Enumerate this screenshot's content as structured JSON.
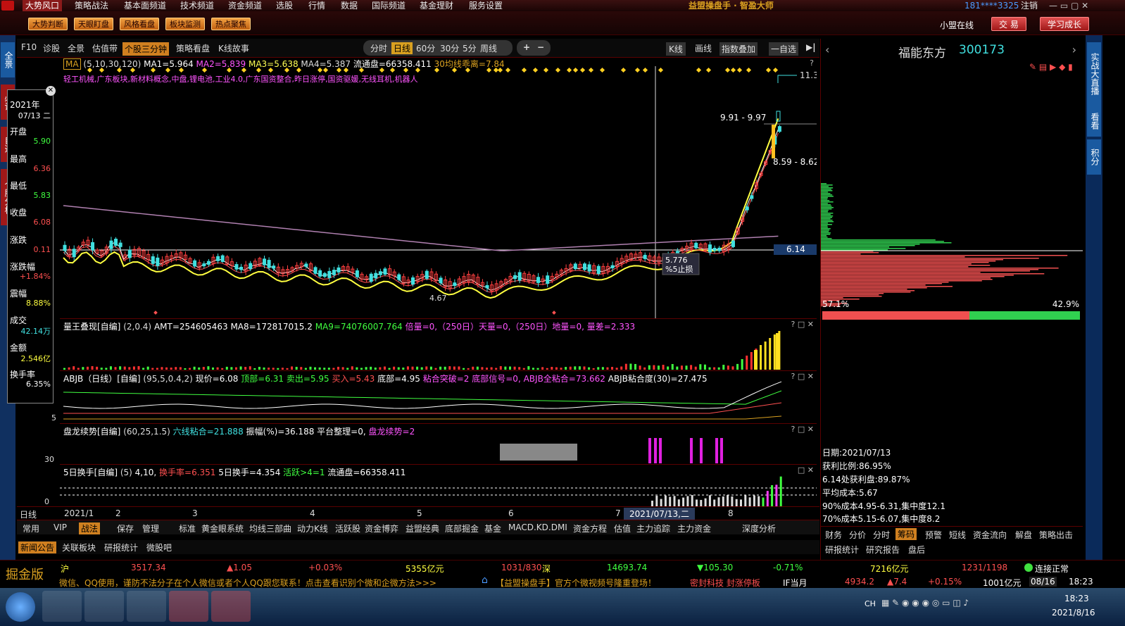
{
  "menu": {
    "items": [
      "大势风口",
      "策略战法",
      "基本面频道",
      "技术频道",
      "资金频道",
      "选股",
      "行情",
      "数据",
      "国际频道",
      "基金理财",
      "服务设置"
    ],
    "app_title": "益盟操盘手 · 智盈大师",
    "user": "181****3325",
    "logout": "注销"
  },
  "toolbar": {
    "buttons": [
      "大势判断",
      "天眼盯盘",
      "风格看盘",
      "板块监测",
      "热点聚焦"
    ],
    "online": "小盟在线",
    "trade": "交 易",
    "learn": "学习成长"
  },
  "chart_tabs": {
    "left": [
      "F10",
      "诊股",
      "全景",
      "估值带",
      "个股三分钟",
      "策略看盘",
      "K线故事"
    ],
    "periods": [
      "分时",
      "日线",
      "60分",
      "30分",
      "5分",
      "周线"
    ],
    "zoom_in": "+",
    "zoom_out": "−",
    "right": [
      "K线",
      "画线",
      "指数叠加",
      "一自选"
    ]
  },
  "main_chart": {
    "ma_label": "MA",
    "params": "(5,10,30,120)",
    "ma1": "MA1=5.964",
    "ma2": "MA2=5.839",
    "ma3": "MA3=5.638",
    "ma4": "MA4=5.387",
    "float": "流通盘=66358.411",
    "dev": "30均线乖离=7.84",
    "concepts": "轻工机械,广东板块,新材料概念,中盘,锂电池,工业4.0,广东国资整合,昨日涨停,国资驱媛,无线耳机,机器人",
    "high": "11.38",
    "range1": "9.91 - 9.97",
    "range2": "8.59 - 8.62",
    "low": "4.67",
    "cur": "6.14",
    "tip1": "5.776",
    "tip2": "%5止损",
    "help": "?"
  },
  "sub1": {
    "title": "量王叠现[自编]",
    "params": "(2,0.4)",
    "amt": "AMT=254605463",
    "ma8": "MA8=172817015.2",
    "ma9": "MA9=74076007.764",
    "bl": "倍量=0,（250日）天量=0,（250日）地量=0,",
    "lc": "量差=2.333"
  },
  "sub2": {
    "title": "ABJB（日线）[自编]",
    "params": "(95,5,0.4,2)",
    "xj": "现价=6.08",
    "db": "顶部=6.31",
    "mc": "卖出=5.95",
    "mr": "买入=5.43",
    "dib": "底部=4.95",
    "nh": "粘合突破=2",
    "dbx": "底部信号=0,",
    "abjb": "ABJB全粘合=73.662",
    "abjb2": "ABJB粘合度(30)=27.475",
    "axis": "5"
  },
  "sub3": {
    "title": "盘龙续势[自编]",
    "params": "(60,25,1.5)",
    "lx": "六线粘合=21.888",
    "zf": "振幅(%)=36.188",
    "pt": "平台整理=0,",
    "pl": "盘龙续势=2",
    "axis": "30"
  },
  "sub4": {
    "title": "5日换手[自编]",
    "params": "(5)",
    "p2": "4,10,",
    "hs": "换手率=6.351",
    "hs5": "5日换手=4.354",
    "hy": "活跃>4=1",
    "lt": "流通盘=66358.411",
    "axis": "0"
  },
  "xaxis": {
    "label": "日线",
    "ticks": [
      "2021/1",
      "2",
      "3",
      "4",
      "5",
      "6",
      "7",
      "8"
    ],
    "cursor": "2021/07/13,二"
  },
  "infobox": {
    "year": "2021年",
    "date": "07/13 二",
    "open_l": "开盘",
    "open": "5.90",
    "high_l": "最高",
    "high": "6.36",
    "low_l": "最低",
    "low": "5.83",
    "close_l": "收盘",
    "close": "6.08",
    "chg_l": "涨跌",
    "chg": "0.11",
    "pct_l": "涨跌幅",
    "pct": "+1.84%",
    "amp_l": "震幅",
    "amp": "8.88%",
    "vol_l": "成交",
    "vol": "42.14万",
    "amt_l": "金额",
    "amt": "2.546亿",
    "turn_l": "换手率",
    "turn": "6.35%"
  },
  "leftbar": [
    "全景",
    "必读",
    "自选",
    "个股分析"
  ],
  "stock": {
    "name": "福能东方",
    "code": "300173"
  },
  "chip": {
    "left_pct": "57.1%",
    "right_pct": "42.9%",
    "date": "日期:2021/07/13",
    "profit": "获利比例:86.95%",
    "at": "6.14处获利盘:89.87%",
    "avg": "平均成本:5.67",
    "c90": "90%成本4.95-6.31,集中度12.1",
    "c70": "70%成本5.15-6.07,集中度8.2"
  },
  "right_tabs": [
    "财务",
    "分价",
    "分时",
    "筹码",
    "预警",
    "短线",
    "资金流向",
    "解盘",
    "策略出击"
  ],
  "right_tabs2": [
    "研报统计",
    "研究报告",
    "盘后"
  ],
  "rightbar": [
    "实战大直播",
    "看看",
    "积分"
  ],
  "bottom_tabs": {
    "left": [
      "常用",
      "VIP",
      "战法",
      "保存",
      "管理"
    ],
    "items": [
      "标准",
      "黄金眼系统",
      "均线三部曲",
      "动力K线",
      "活跃股",
      "资金博弈",
      "益盟经典",
      "底部掘金",
      "基金",
      "MACD.KD.DMI",
      "资金方程",
      "估值",
      "主力追踪",
      "主力资金"
    ],
    "right": "深度分析"
  },
  "news_tabs": [
    "新闻公告",
    "关联板块",
    "研报统计",
    "微股吧"
  ],
  "status": {
    "brand": "掘金版",
    "sh_l": "沪",
    "sh": "3517.34",
    "sh_chg": "▲1.05",
    "sh_pct": "+0.03%",
    "sh_amt": "5355亿元",
    "sh_ud": "1031/830",
    "sz_l": "深",
    "sz": "14693.74",
    "sz_chg": "▼105.30",
    "sz_pct": "-0.71%",
    "sz_amt": "7216亿元",
    "sz_ud": "1231/1198",
    "conn": "连接正常",
    "ticker": "微信、QQ使用，谨防不法分子在个人微信或者个人QQ跟您联系！点击查看识别个微和企微方法>>>",
    "ticker2": "【益盟操盘手】官方个微视频号隆重登场！",
    "ticker3": "密封科技 封涨停板",
    "if_l": "IF当月",
    "if": "4934.2",
    "if_chg": "▲7.4",
    "if_pct": "+0.15%",
    "if_amt": "1001亿元",
    "date": "08/16",
    "time": "18:23"
  },
  "taskbar": {
    "lang": "CH",
    "time": "18:23",
    "date": "2021/8/16"
  }
}
